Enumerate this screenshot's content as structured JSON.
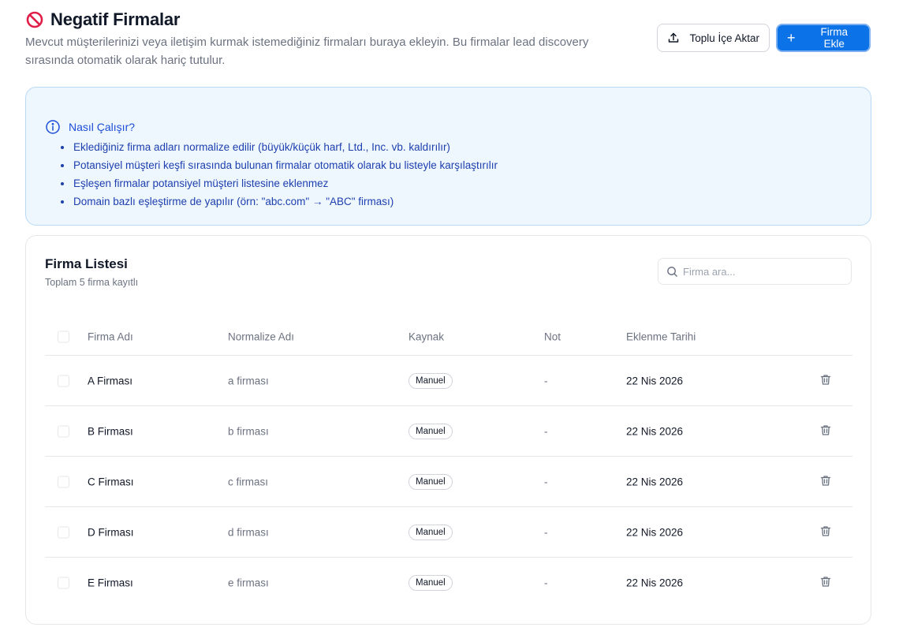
{
  "header": {
    "title": "Negatif Firmalar",
    "subtitle": "Mevcut müşterilerinizi veya iletişim kurmak istemediğiniz firmaları buraya ekleyin. Bu firmalar lead discovery sırasında otomatik olarak hariç tutulur.",
    "icon": "prohibited-icon",
    "import_label": "Toplu İçe Aktar",
    "add_label": "Firma Ekle",
    "accent_color": "#0b72e7"
  },
  "info": {
    "title": "Nasıl Çalışır?",
    "items": [
      "Eklediğiniz firma adları normalize edilir (büyük/küçük harf, Ltd., Inc. vb. kaldırılır)",
      "Potansiyel müşteri keşfi sırasında bulunan firmalar otomatik olarak bu listeyle karşılaştırılır",
      "Eşleşen firmalar potansiyel müşteri listesine eklenmez",
      "Domain bazlı eşleştirme de yapılır (örn: \"abc.com\" → \"ABC\" firması)"
    ]
  },
  "list": {
    "title": "Firma Listesi",
    "subtitle": "Toplam 5 firma kayıtlı",
    "search_placeholder": "Firma ara...",
    "columns": {
      "name": "Firma Adı",
      "normalized": "Normalize Adı",
      "source": "Kaynak",
      "note": "Not",
      "date": "Eklenme Tarihi"
    },
    "rows": [
      {
        "name": "A Firması",
        "normalized": "a firması",
        "source": "Manuel",
        "note": "-",
        "date": "22 Nis 2026"
      },
      {
        "name": "B Firması",
        "normalized": "b firması",
        "source": "Manuel",
        "note": "-",
        "date": "22 Nis 2026"
      },
      {
        "name": "C Firması",
        "normalized": "c firması",
        "source": "Manuel",
        "note": "-",
        "date": "22 Nis 2026"
      },
      {
        "name": "D Firması",
        "normalized": "d firması",
        "source": "Manuel",
        "note": "-",
        "date": "22 Nis 2026"
      },
      {
        "name": "E Firması",
        "normalized": "e firması",
        "source": "Manuel",
        "note": "-",
        "date": "22 Nis 2026"
      }
    ]
  }
}
